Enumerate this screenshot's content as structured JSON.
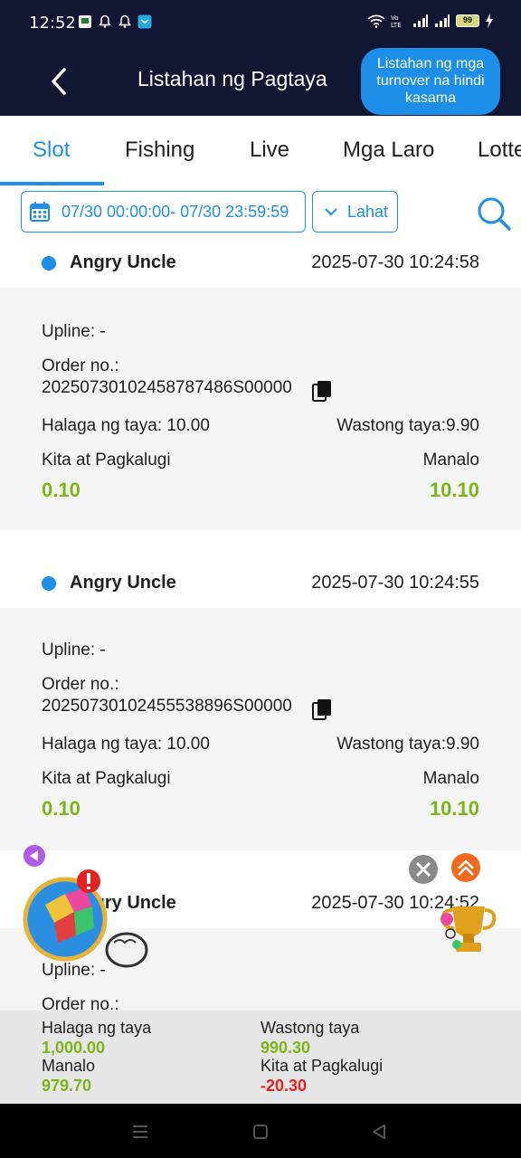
{
  "status_bar": {
    "time": "12:52",
    "battery": "99",
    "icons": [
      "notification-app-icon",
      "bell-icon",
      "bell-icon",
      "chat-app-icon",
      "wifi-icon",
      "volte-icon",
      "signal-icon",
      "signal-icon",
      "battery-icon",
      "charging-icon"
    ]
  },
  "header": {
    "title": "Listahan ng Pagtaya",
    "turnover_button": "Listahan ng mga turnover na hindi kasama"
  },
  "tabs": [
    {
      "label": "Slot",
      "active": true
    },
    {
      "label": "Fishing",
      "active": false
    },
    {
      "label": "Live",
      "active": false
    },
    {
      "label": "Mga Laro",
      "active": false
    },
    {
      "label": "Lotte",
      "active": false
    }
  ],
  "filters": {
    "date_range": "07/30 00:00:00- 07/30 23:59:59",
    "type": "Lahat"
  },
  "records": [
    {
      "game": "Angry Uncle",
      "timestamp": "2025-07-30 10:24:58",
      "upline": "Upline: -",
      "order_label": "Order no.:",
      "order_no": "20250730102458787486S00000",
      "bet_amount": "Halaga ng taya: 10.00",
      "valid_bet": "Wastong taya:9.90",
      "profit_label": "Kita at Pagkalugi",
      "profit_value": "0.10",
      "win_label": "Manalo",
      "win_value": "10.10"
    },
    {
      "game": "Angry Uncle",
      "timestamp": "2025-07-30 10:24:55",
      "upline": "Upline: -",
      "order_label": "Order no.:",
      "order_no": "20250730102455538896S00000",
      "bet_amount": "Halaga ng taya: 10.00",
      "valid_bet": "Wastong taya:9.90",
      "profit_label": "Kita at Pagkalugi",
      "profit_value": "0.10",
      "win_label": "Manalo",
      "win_value": "10.10"
    },
    {
      "game": "Angry Uncle",
      "timestamp": "2025-07-30 10:24:52",
      "upline": "Upline: -",
      "order_label": "Order no.:"
    }
  ],
  "summary": {
    "bet_label": "Halaga ng taya",
    "bet_value": "1,000.00",
    "valid_label": "Wastong taya",
    "valid_value": "990.30",
    "win_label": "Manalo",
    "win_value": "979.70",
    "profit_label": "Kita at Pagkalugi",
    "profit_value": "-20.30"
  },
  "colors": {
    "header_bg": "#111633",
    "accent": "#1e8fe8",
    "positive": "#7cb518",
    "negative": "#e52222"
  }
}
